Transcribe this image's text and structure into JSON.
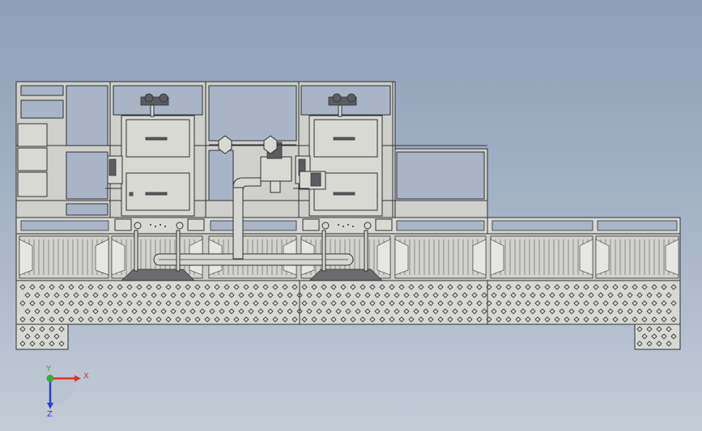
{
  "viewport": {
    "background_top": "#8f9fb6",
    "background_bottom": "#c3cbd6",
    "line_color": "#2f3134",
    "part_fill": "#d9d9d4"
  },
  "triad": {
    "x_label": "X",
    "y_label": "Y",
    "z_label": "Z",
    "x_color": "#e03030",
    "y_color": "#30b030",
    "z_color": "#2c3fd0"
  },
  "icons": {
    "triad": "coordinate-triad-icon"
  }
}
